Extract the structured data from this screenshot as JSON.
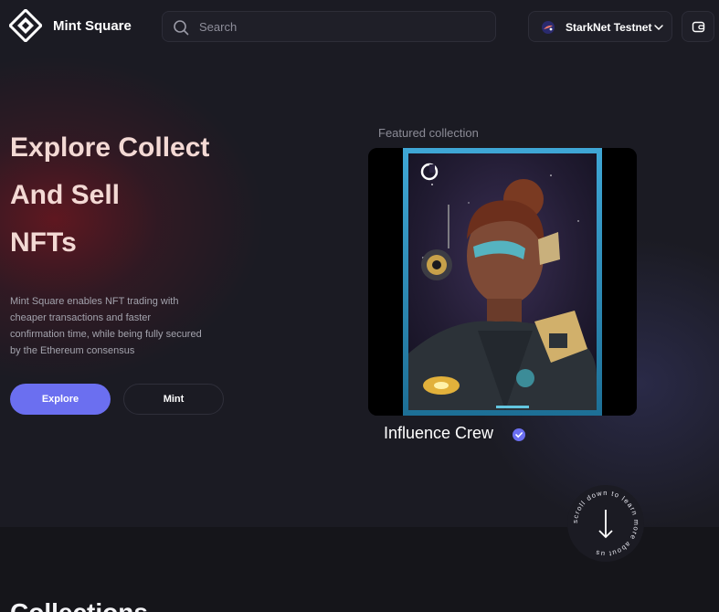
{
  "header": {
    "brand": "Mint Square",
    "search": {
      "placeholder": "Search",
      "value": ""
    },
    "network": {
      "label": "StarkNet Testnet"
    }
  },
  "hero": {
    "title_lines": [
      "Explore Collect",
      "And Sell",
      "NFTs"
    ],
    "description": "Mint Square enables NFT trading with cheaper transactions and faster confirmation time, while being fully secured by the Ethereum consensus",
    "explore_label": "Explore",
    "mint_label": "Mint"
  },
  "featured": {
    "label": "Featured collection",
    "collection_name": "Influence Crew"
  },
  "scroll_hint": {
    "text": "scroll down to learn more about us"
  },
  "sections": {
    "collections_heading": "Collections"
  },
  "colors": {
    "background": "#1b1b23",
    "accent": "#6b6ff0",
    "hero_title": "#f3d9d4",
    "verified": "#6b6ff0"
  },
  "icons": [
    "logo-icon",
    "search-icon",
    "starknet-icon",
    "chevron-down-icon",
    "wallet-icon",
    "verified-icon",
    "arrow-down-icon"
  ]
}
